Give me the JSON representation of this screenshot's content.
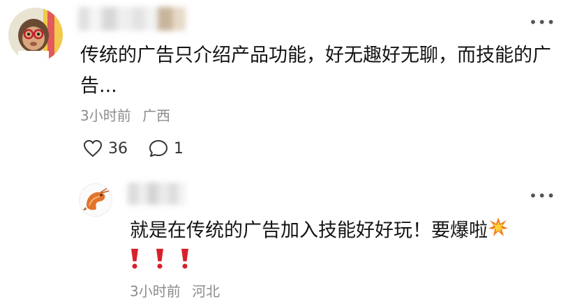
{
  "comment": {
    "text": "传统的广告只介绍产品功能，好无趣好无聊，而技能的广告...",
    "time": "3小时前",
    "location": "广西",
    "like_count": "36",
    "reply_count": "1"
  },
  "reply": {
    "text": "就是在传统的广告加入技能好好玩！要爆啦",
    "time": "3小时前",
    "location": "河北"
  },
  "icons": {
    "more": "more-icon",
    "like": "heart-icon",
    "reply": "comment-bubble-icon",
    "burst": "collision-emoji",
    "exclaim": "exclamation-emoji"
  },
  "colors": {
    "meta": "#8c8c8c",
    "text": "#141414",
    "exclaim": "#d8202b"
  }
}
